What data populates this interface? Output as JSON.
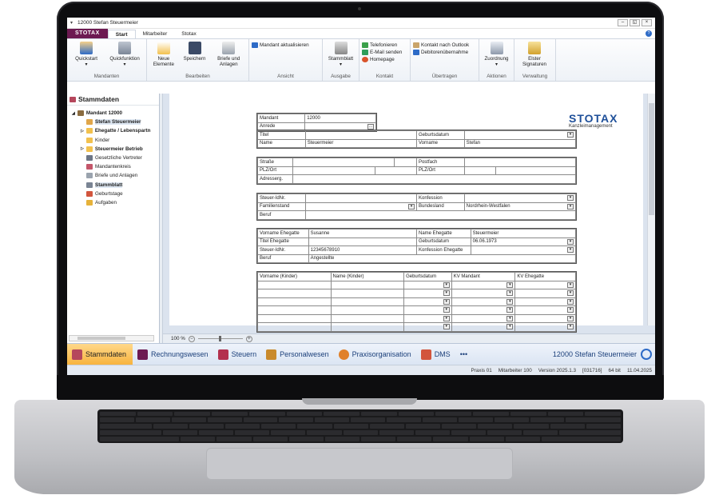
{
  "window": {
    "title": "12000 Stefan Steuermeier",
    "quick_access": "▾",
    "minimize": "–",
    "restore": "◱",
    "close": "×"
  },
  "tabs": {
    "logo": "STOTAX",
    "items": [
      "Start",
      "Mitarbeiter",
      "Stotax"
    ],
    "active": "Start",
    "help": "?"
  },
  "ribbon": {
    "mandanten": {
      "label": "Mandanten",
      "quickstart": "Quickstart",
      "quickfunktion": "Quickfunktion"
    },
    "bearbeiten": {
      "label": "Bearbeiten",
      "neue_elemente": "Neue Elemente",
      "speichern": "Speichern",
      "briefe": "Briefe und Anlagen"
    },
    "ansicht": {
      "label": "Ansicht",
      "mandant_akt": "Mandant aktualisieren"
    },
    "ausgabe": {
      "label": "Ausgabe",
      "stammblatt": "Stammblatt"
    },
    "kontakt": {
      "label": "Kontakt",
      "telefonieren": "Telefonieren",
      "email": "E-Mail senden",
      "homepage": "Homepage"
    },
    "uebertragen": {
      "label": "Übertragen",
      "outlook": "Kontakt nach Outlook",
      "debitoren": "Debitorenübernahme"
    },
    "aktionen": {
      "label": "Aktionen",
      "zuordnung": "Zuordnung"
    },
    "verwaltung": {
      "label": "Verwaltung",
      "elster": "Elster Signaturen"
    }
  },
  "sidebar": {
    "title": "Stammdaten",
    "items": [
      {
        "label": "Mandant 12000",
        "bold": true,
        "indent": 0
      },
      {
        "label": "Stefan Steuermeier",
        "bold": true,
        "indent": 1
      },
      {
        "label": "Ehegatte / Lebenspartn",
        "bold": true,
        "indent": 1
      },
      {
        "label": "Kinder",
        "bold": false,
        "indent": 1
      },
      {
        "label": "Steuermeier Betrieb",
        "bold": true,
        "indent": 1
      },
      {
        "label": "Gesetzliche Vertreter",
        "bold": false,
        "indent": 1
      },
      {
        "label": "Mandantenkreis",
        "bold": false,
        "indent": 1
      },
      {
        "label": "Briefe und Anlagen",
        "bold": false,
        "indent": 1
      },
      {
        "label": "Stammblatt",
        "bold": true,
        "indent": 1
      },
      {
        "label": "Geburtstage",
        "bold": false,
        "indent": 1
      },
      {
        "label": "Aufgaben",
        "bold": false,
        "indent": 1
      }
    ]
  },
  "form": {
    "logo": "STOTAX",
    "logo_sub": "Kanzleimanagement",
    "mandant_label": "Mandant",
    "mandant_value": "12000",
    "anrede_label": "Anrede",
    "titel_label": "Titel",
    "geburtsdatum_label": "Geburtsdatum",
    "name_label": "Name",
    "name_value": "Steuermeier",
    "vorname_label": "Vorname",
    "vorname_value": "Stefan",
    "strasse_label": "Straße",
    "postfach_label": "Postfach",
    "plzort_label": "PLZ/Ort",
    "plzort2_label": "PLZ/Ort",
    "adresserg_label": "Adresserg.",
    "steuerid_label": "Steuer-IdNr.",
    "konfession_label": "Konfession",
    "familienstand_label": "Familienstand",
    "bundesland_label": "Bundesland",
    "bundesland_value": "Nordrhein-Westfalen",
    "beruf_label": "Beruf",
    "vorname_eheg_label": "Vorname Ehegatte",
    "vorname_eheg_value": "Susanne",
    "name_eheg_label": "Name Ehegatte",
    "name_eheg_value": "Steuermeier",
    "titel_eheg_label": "Titel Ehegatte",
    "geburtsdatum_eheg_label": "Geburtsdatum",
    "geburtsdatum_eheg_value": "06.06.1973",
    "steuerid_eheg_label": "Steuer-IdNr.",
    "steuerid_eheg_value": "12345678910",
    "konfession_eheg_label": "Konfession Ehegatte",
    "beruf_eheg_label": "Beruf",
    "beruf_eheg_value": "Angestellte",
    "kinder_headers": [
      "Vorname (Kinder)",
      "Name (Kinder)",
      "Geburtsdatum",
      "KV Mandant",
      "KV Ehegatte"
    ]
  },
  "zoom": {
    "level": "100 %",
    "minus": "−",
    "plus": "+"
  },
  "bottomnav": {
    "items": [
      "Stammdaten",
      "Rechnungswesen",
      "Steuern",
      "Personalwesen",
      "Praxisorganisation",
      "DMS",
      "•••"
    ],
    "active": "Stammdaten",
    "client": "12000 Stefan Steuermeier"
  },
  "status": {
    "praxis": "Praxis 01",
    "mitarbeiter": "Mitarbeiter 100",
    "version": "Version 2025.1.3",
    "build": "[031716]",
    "bits": "64 bit",
    "date": "11.04.2025"
  },
  "colors": {
    "brand": "#6d1a52",
    "accent": "#2e6bc7",
    "active_nav": "#f7b23b",
    "logo_blue": "#1e4f99"
  }
}
